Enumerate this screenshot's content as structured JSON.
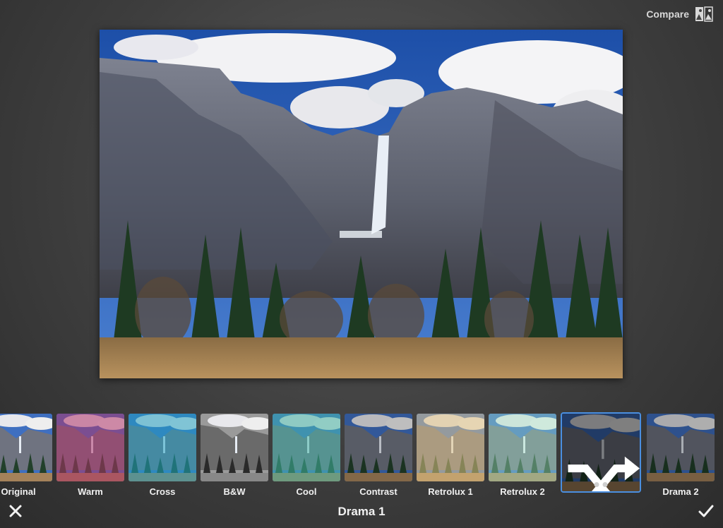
{
  "toolbar": {
    "compare_label": "Compare",
    "compare_icon": "compare-icon"
  },
  "filters": [
    {
      "label": "Original",
      "tint": "#00000000"
    },
    {
      "label": "Warm",
      "tint": "#b0306888"
    },
    {
      "label": "Cross",
      "tint": "#20a0c088"
    },
    {
      "label": "B&W",
      "tint": "grayscale"
    },
    {
      "label": "Cool",
      "tint": "#40b0a088"
    },
    {
      "label": "Contrast",
      "tint": "#00000033"
    },
    {
      "label": "Retrolux 1",
      "tint": "#e0c08088"
    },
    {
      "label": "Retrolux 2",
      "tint": "#a0e0c066"
    },
    {
      "label": "Drama 1",
      "tint": "#00000077",
      "selected": true
    },
    {
      "label": "Drama 2",
      "tint": "#00000044"
    }
  ],
  "bottom": {
    "current_filter": "Drama 1",
    "cancel_icon": "close-icon",
    "apply_icon": "checkmark-icon"
  },
  "colors": {
    "accent": "#4a8fe0",
    "background": "#3e3e3e"
  }
}
